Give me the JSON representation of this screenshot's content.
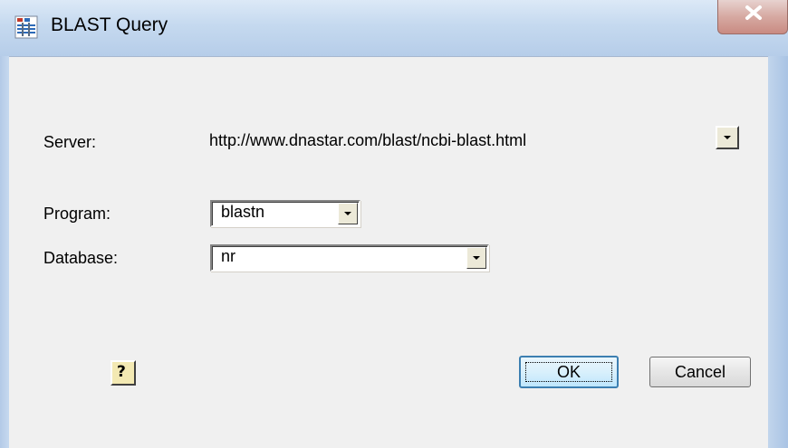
{
  "window": {
    "title": "BLAST Query",
    "title_icon": "blast-app-icon",
    "close_icon": "close-x-icon"
  },
  "server": {
    "label": "Server:",
    "value": "http://www.dnastar.com/blast/ncbi-blast.html"
  },
  "program": {
    "label": "Program:",
    "value": "blastn"
  },
  "database": {
    "label": "Database:",
    "value": "nr"
  },
  "buttons": {
    "help_icon": "help-question-icon",
    "help_glyph": "?",
    "ok_label": "OK",
    "cancel_label": "Cancel"
  },
  "colors": {
    "titlebar": "#c5d9ef",
    "client_bg": "#f0f0f0",
    "ok_border": "#3c7fb1",
    "close_button": "#d6a9a2"
  }
}
